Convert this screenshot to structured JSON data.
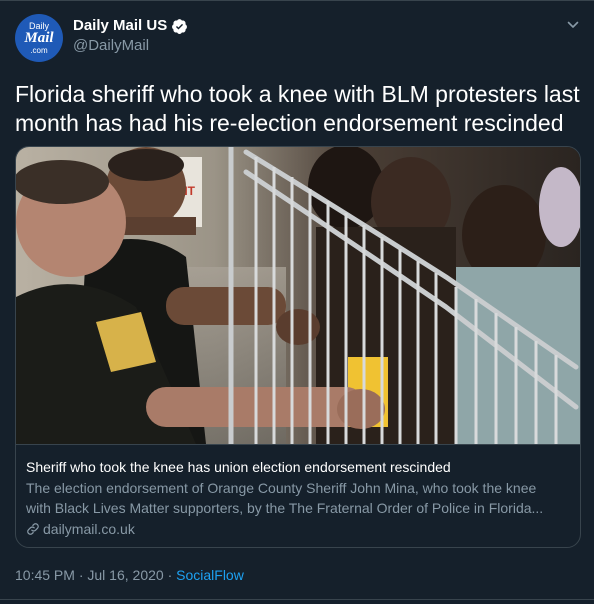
{
  "account": {
    "avatar_lines": [
      "Daily",
      "Mail",
      ".com"
    ],
    "display_name": "Daily Mail US",
    "handle": "@DailyMail",
    "verified": true
  },
  "tweet": {
    "text": "Florida sheriff who took a knee with BLM protesters last month has had his re-election endorsement rescinded"
  },
  "card": {
    "title": "Sheriff who took the knee has union election endorsement rescinded",
    "description_lines": [
      "The election endorsement of Orange County Sheriff John Mina, who took the knee",
      "with Black Lives Matter supporters, by the The Fraternal Order of Police in Florida..."
    ],
    "domain": "dailymail.co.uk"
  },
  "meta": {
    "time": "10:45 PM",
    "date": "Jul 16, 2020",
    "separator": " · ",
    "source": "SocialFlow"
  },
  "colors": {
    "background": "#15202b",
    "border": "#38444d",
    "secondary_text": "#8899a6",
    "accent": "#1da1f2",
    "avatar": "#1f5ab7"
  },
  "icons": [
    "verified-badge-icon",
    "chevron-down-icon",
    "link-icon"
  ]
}
